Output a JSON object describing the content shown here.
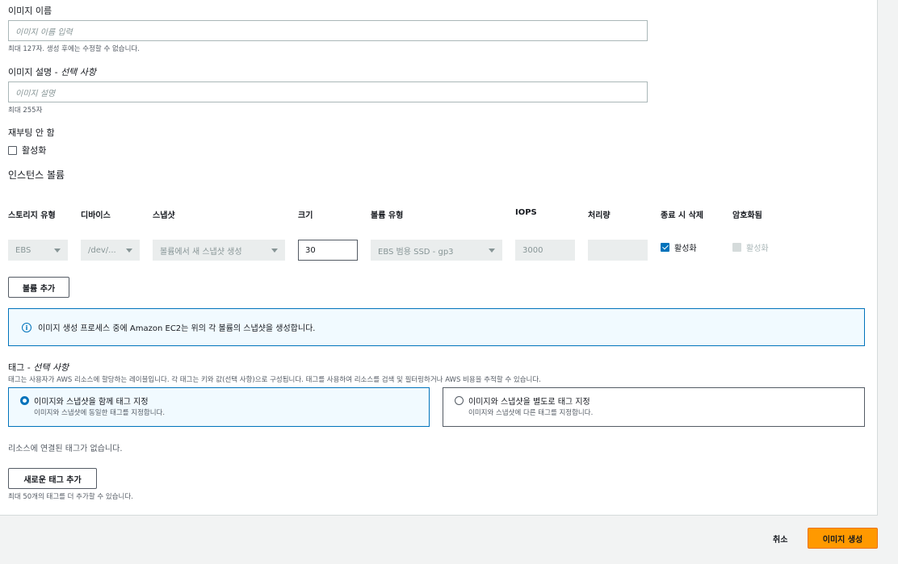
{
  "image_name": {
    "label": "이미지 이름",
    "placeholder": "이미지 이름 입력",
    "hint": "최대 127자. 생성 후에는 수정할 수 없습니다."
  },
  "image_description": {
    "label": "이미지 설명 - ",
    "label_optional": "선택 사항",
    "placeholder": "이미지 설명",
    "hint": "최대 255자"
  },
  "no_reboot": {
    "label": "재부팅 안 함",
    "checkbox_label": "활성화"
  },
  "volumes": {
    "title": "인스턴스 볼륨",
    "headers": [
      "스토리지 유형",
      "디바이스",
      "스냅샷",
      "크기",
      "볼륨 유형",
      "IOPS",
      "처리량",
      "종료 시 삭제",
      "암호화됨"
    ],
    "row": {
      "storage_type": "EBS",
      "device": "/dev/...",
      "snapshot": "볼륨에서 새 스냅샷 생성",
      "size": "30",
      "volume_type": "EBS 범용 SSD - gp3",
      "iops": "3000",
      "throughput": "",
      "delete_on_termination_label": "활성화",
      "encrypted_label": "활성화"
    },
    "add_volume_button": "볼륨 추가"
  },
  "info_alert": {
    "icon": "info-icon",
    "text": "이미지 생성 프로세스 중에 Amazon EC2는 위의 각 볼륨의 스냅샷을 생성합니다."
  },
  "tags": {
    "label": "태그 - ",
    "label_optional": "선택 사항",
    "description": "태그는 사용자가 AWS 리소스에 할당하는 레이블입니다. 각 태그는 키와 값(선택 사항)으로 구성됩니다. 태그를 사용하여 리소스를 검색 및 필터링하거나 AWS 비용을 추적할 수 있습니다.",
    "options": [
      {
        "title": "이미지와 스냅샷을 함께 태그 지정",
        "subtitle": "이미지와 스냅샷에 동일한 태그를 지정합니다."
      },
      {
        "title": "이미지와 스냅샷을 별도로 태그 지정",
        "subtitle": "이미지와 스냅샷에 다른 태그를 지정합니다."
      }
    ],
    "empty_text": "리소스에 연결된 태그가 없습니다.",
    "add_tag_button": "새로운 태그 추가",
    "add_tag_hint": "최대 50개의 태그를 더 추가할 수 있습니다."
  },
  "footer": {
    "cancel_label": "취소",
    "create_label": "이미지 생성"
  },
  "colors": {
    "accent": "#0073bb",
    "primary_button": "#ff9900",
    "info_bg": "#f1faff"
  }
}
